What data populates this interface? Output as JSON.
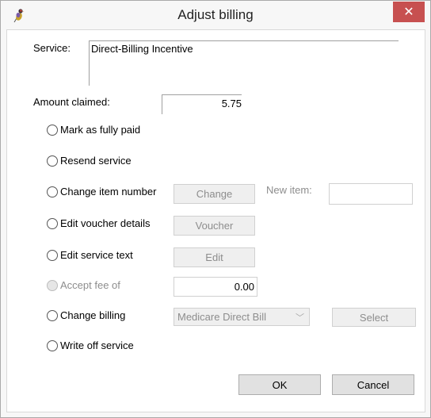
{
  "window": {
    "title": "Adjust billing",
    "app_icon": "finch-bird-icon",
    "close_icon": "close-icon",
    "close_glyph": "✕"
  },
  "service": {
    "label": "Service:",
    "value": "Direct-Billing Incentive"
  },
  "amount": {
    "label": "Amount claimed:",
    "value": "5.75"
  },
  "options": [
    {
      "label": "Mark as fully paid",
      "selected": false,
      "enabled": true
    },
    {
      "label": "Resend service",
      "selected": false,
      "enabled": true
    },
    {
      "label": "Change item number",
      "selected": false,
      "enabled": true
    },
    {
      "label": "Edit voucher details",
      "selected": false,
      "enabled": true
    },
    {
      "label": "Edit service text",
      "selected": false,
      "enabled": true
    },
    {
      "label": "Accept fee of",
      "selected": false,
      "enabled": false
    },
    {
      "label": "Change billing",
      "selected": false,
      "enabled": true
    },
    {
      "label": "Write off service",
      "selected": false,
      "enabled": true
    }
  ],
  "controls": {
    "change_button": "Change",
    "new_item_label": "New item:",
    "new_item_value": "",
    "voucher_button": "Voucher",
    "edit_button": "Edit",
    "accept_fee_value": "0.00",
    "billing_select_value": "Medicare Direct Bill",
    "billing_chevron": "﹀",
    "select_button": "Select"
  },
  "footer": {
    "ok_label": "OK",
    "cancel_label": "Cancel"
  }
}
